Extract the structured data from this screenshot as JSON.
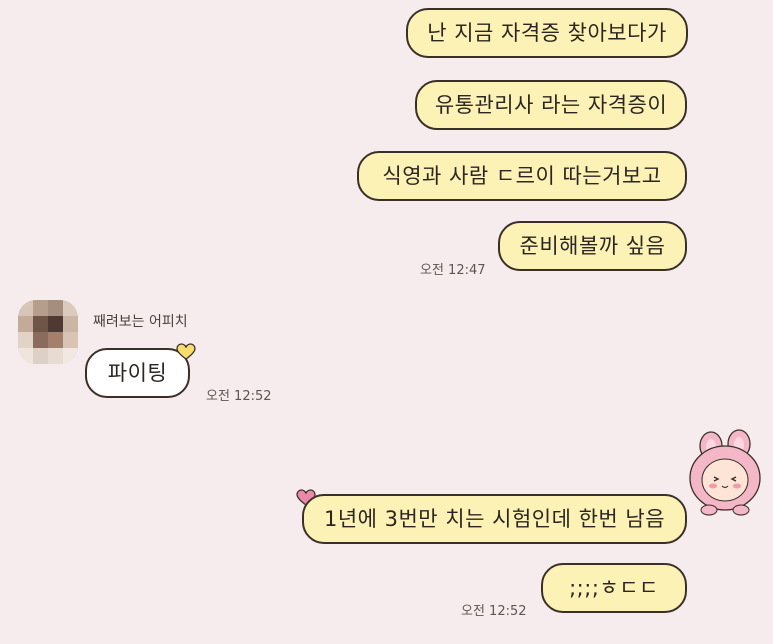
{
  "messages": [
    {
      "text": "난 지금 자격증 찾아보다가"
    },
    {
      "text": "유통관리사 라는 자격증이"
    },
    {
      "text": "식영과 사람 ㄷ르이 따는거보고"
    },
    {
      "text": "준비해볼까 싶음"
    },
    {
      "text": "파이팅"
    },
    {
      "text": "1년에 3번만 치는 시험인데 한번 남음"
    },
    {
      "text": ";;;;ㅎㄷㄷ"
    }
  ],
  "times": {
    "t1": "오전 12:47",
    "t2": "오전 12:52",
    "t3": "오전 12:52"
  },
  "other_user": {
    "name": "째려보는 어피치"
  },
  "icons": {
    "heart_color": "#f7dc6f",
    "heart_pink": "#ea8aa8",
    "avatar": "profile-avatar-blurred",
    "sticker": "pink-bunny-sticker"
  },
  "colors": {
    "my_bubble": "#fdf2b6",
    "their_bubble": "#ffffff",
    "background": "#f6ecee"
  }
}
